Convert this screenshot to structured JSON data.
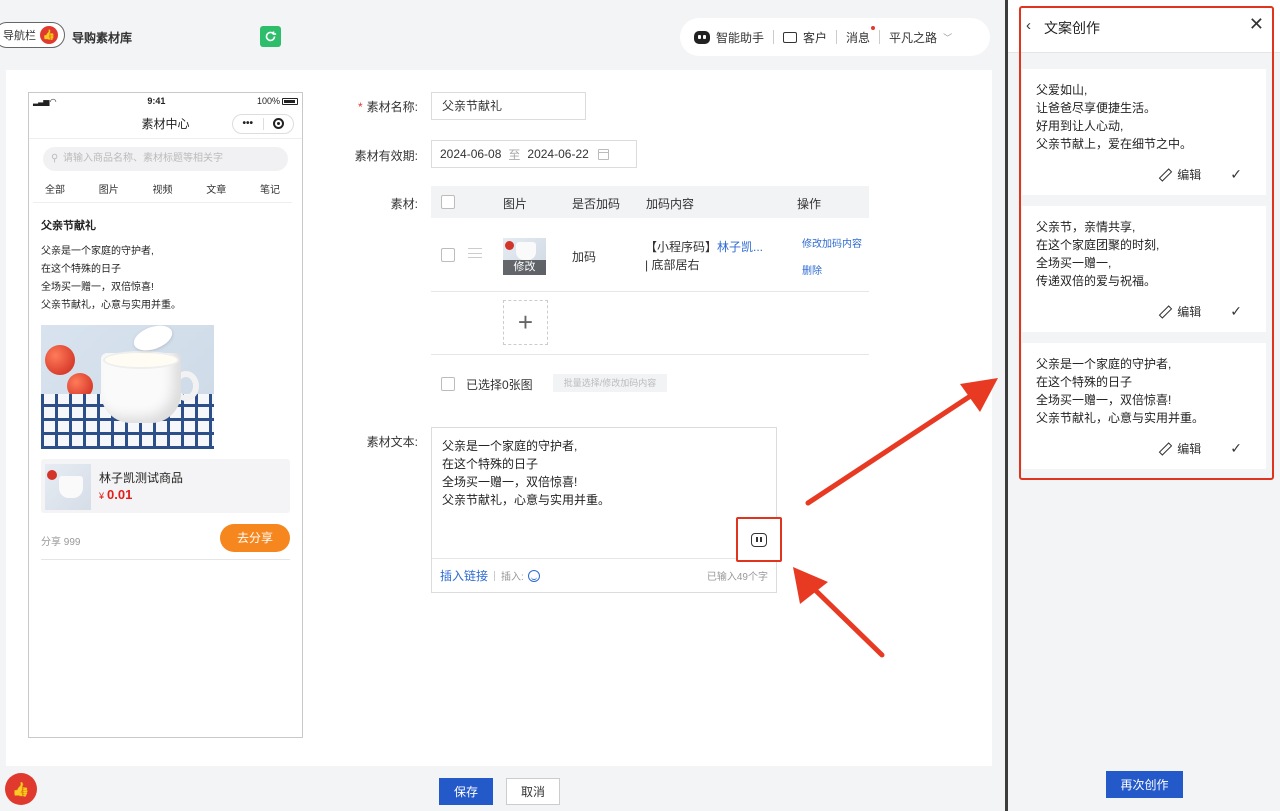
{
  "topbar": {
    "nav_toggle_label": "导航栏",
    "app_title": "导购素材库",
    "assistant_label": "智能助手",
    "customer_label": "客户",
    "message_label": "消息",
    "user_name": "平凡之路"
  },
  "phone": {
    "time": "9:41",
    "battery": "100%",
    "header_title": "素材中心",
    "capsule_more": "•••",
    "search_placeholder": "请输入商品名称、素材标题等相关字",
    "tabs": [
      "全部",
      "图片",
      "视频",
      "文章",
      "笔记"
    ],
    "post_title": "父亲节献礼",
    "post_body": "父亲是一个家庭的守护者,\n在这个特殊的日子\n全场买一赠一，双倍惊喜!\n父亲节献礼，心意与实用并重。",
    "product_name": "林子凯测试商品",
    "price_symbol": "¥",
    "price_value": "0.01",
    "share_count": "分享 999",
    "share_button": "去分享"
  },
  "form": {
    "name_label": "素材名称:",
    "name_value": "父亲节献礼",
    "validity_label": "素材有效期:",
    "date_start": "2024-06-08",
    "date_to": "至",
    "date_end": "2024-06-22",
    "material_label": "素材:",
    "columns": [
      "图片",
      "是否加码",
      "加码内容",
      "操作"
    ],
    "row": {
      "image_edit": "修改",
      "code_flag": "加码",
      "code_prefix": "【小程序码】",
      "code_link": "林子凯...",
      "code_suffix": "| 底部居右",
      "op_modify": "修改加码内容",
      "op_delete": "删除"
    },
    "selected_info": "已选择0张图",
    "batch_button": "批量选择/修改加码内容",
    "text_label": "素材文本:",
    "text_value": "父亲是一个家庭的守护者,\n在这个特殊的日子\n全场买一赠一，双倍惊喜!\n父亲节献礼，心意与实用并重。",
    "insert_link": "插入链接",
    "insert_label": "插入:",
    "char_count": "已输入49个字"
  },
  "actions": {
    "save": "保存",
    "cancel": "取消"
  },
  "panel": {
    "title": "文案创作",
    "cards": [
      {
        "text": "父爱如山,\n让爸爸尽享便捷生活。\n好用到让人心动,\n父亲节献上，爱在细节之中。",
        "edit": "编辑"
      },
      {
        "text": "父亲节，亲情共享,\n在这个家庭团聚的时刻,\n全场买一赠一,\n传递双倍的爱与祝福。",
        "edit": "编辑"
      },
      {
        "text": "父亲是一个家庭的守护者,\n在这个特殊的日子\n全场买一赠一，双倍惊喜!\n父亲节献礼，心意与实用并重。",
        "edit": "编辑"
      }
    ],
    "recreate_button": "再次创作"
  },
  "colors": {
    "primary": "#2459c9",
    "accent_red": "#e0341f",
    "share_orange": "#f6871f",
    "price_red": "#e0201a",
    "link_blue": "#2d6ad2"
  }
}
